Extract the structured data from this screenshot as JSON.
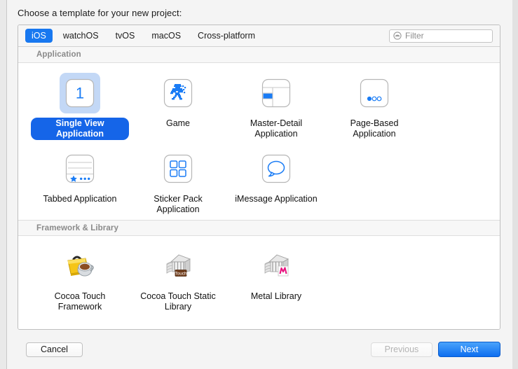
{
  "dialog": {
    "prompt": "Choose a template for your new project:"
  },
  "tabs": [
    {
      "label": "iOS",
      "selected": true
    },
    {
      "label": "watchOS",
      "selected": false
    },
    {
      "label": "tvOS",
      "selected": false
    },
    {
      "label": "macOS",
      "selected": false
    },
    {
      "label": "Cross-platform",
      "selected": false
    }
  ],
  "filter": {
    "placeholder": "Filter",
    "value": "",
    "icon": "filter-icon"
  },
  "sections": [
    {
      "title": "Application",
      "items": [
        {
          "label": "Single View Application",
          "icon": "single-view-icon",
          "selected": true
        },
        {
          "label": "Game",
          "icon": "game-sprite-icon",
          "selected": false
        },
        {
          "label": "Master-Detail Application",
          "icon": "master-detail-icon",
          "selected": false
        },
        {
          "label": "Page-Based Application",
          "icon": "page-based-icon",
          "selected": false
        },
        {
          "label": "Tabbed Application",
          "icon": "tabbed-icon",
          "selected": false
        },
        {
          "label": "Sticker Pack Application",
          "icon": "sticker-pack-icon",
          "selected": false
        },
        {
          "label": "iMessage Application",
          "icon": "imessage-bubble-icon",
          "selected": false
        }
      ]
    },
    {
      "title": "Framework & Library",
      "items": [
        {
          "label": "Cocoa Touch Framework",
          "icon": "toolbox-coffee-icon",
          "selected": false
        },
        {
          "label": "Cocoa Touch Static Library",
          "icon": "library-touch-icon",
          "selected": false
        },
        {
          "label": "Metal Library",
          "icon": "library-metal-icon",
          "selected": false
        }
      ]
    }
  ],
  "footer": {
    "cancel_label": "Cancel",
    "previous_label": "Previous",
    "next_label": "Next"
  },
  "colors": {
    "accent_blue": "#1878f0",
    "selection_fill": "#c3d8f6",
    "selected_label": "#1565e8",
    "icon_blue": "#1a7cf5"
  }
}
